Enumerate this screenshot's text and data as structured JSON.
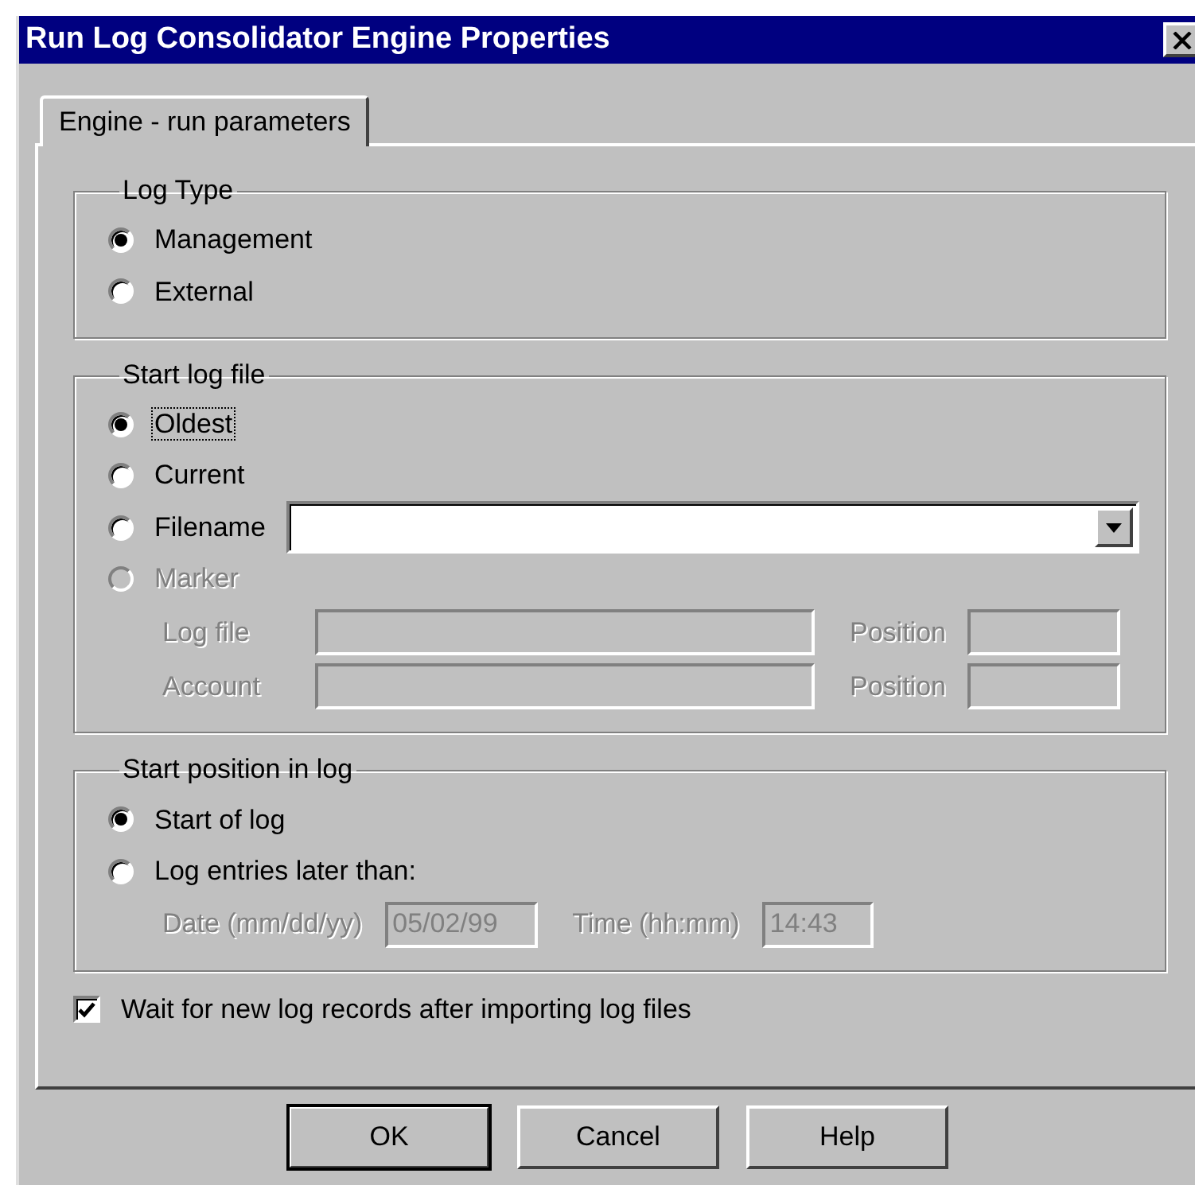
{
  "window": {
    "title": "Run Log Consolidator Engine Properties"
  },
  "tabs": [
    {
      "label": "Engine - run parameters",
      "selected": true
    }
  ],
  "groups": [
    {
      "title": "Log Type",
      "rows": [
        {
          "kind": "radio",
          "label": "Management",
          "selected": true,
          "disabled": false,
          "focused": false
        },
        {
          "kind": "radio",
          "label": "External",
          "selected": false,
          "disabled": false,
          "focused": false
        }
      ]
    },
    {
      "title": "Start log file",
      "rows": [
        {
          "kind": "radio",
          "label": "Oldest",
          "selected": true,
          "disabled": false,
          "focused": true
        },
        {
          "kind": "radio",
          "label": "Current",
          "selected": false,
          "disabled": false,
          "focused": false
        },
        {
          "kind": "radio-combo",
          "label": "Filename",
          "selected": false,
          "disabled": false,
          "focused": false
        },
        {
          "kind": "radio",
          "label": "Marker",
          "selected": false,
          "disabled": true,
          "focused": false
        },
        {
          "kind": "fields",
          "fields": [
            {
              "kind": "wide",
              "label": "Log file",
              "disabled": true
            },
            {
              "kind": "short",
              "label": "Position",
              "disabled": true
            }
          ]
        },
        {
          "kind": "fields",
          "fields": [
            {
              "kind": "wide",
              "label": "Account",
              "disabled": true
            },
            {
              "kind": "short",
              "label": "Position",
              "disabled": true
            }
          ]
        }
      ]
    },
    {
      "title": "Start position in log",
      "rows": [
        {
          "kind": "radio",
          "label": "Start of log",
          "selected": true,
          "disabled": false,
          "focused": false
        },
        {
          "kind": "radio",
          "label": "Log entries later than:",
          "selected": false,
          "disabled": false,
          "focused": false
        },
        {
          "kind": "fields",
          "fields": [
            {
              "kind": "short",
              "label": "Date (mm/dd/yy)",
              "value": "05/02/99",
              "disabled": true
            },
            {
              "kind": "compact",
              "label": "Time (hh:mm)",
              "value": "14:43",
              "disabled": true
            }
          ]
        }
      ]
    }
  ],
  "checkbox": {
    "label": "Wait for new log records after importing log files",
    "checked": true
  },
  "buttons": [
    {
      "label": "OK",
      "default": true
    },
    {
      "label": "Cancel",
      "default": false
    },
    {
      "label": "Help",
      "default": false
    }
  ]
}
